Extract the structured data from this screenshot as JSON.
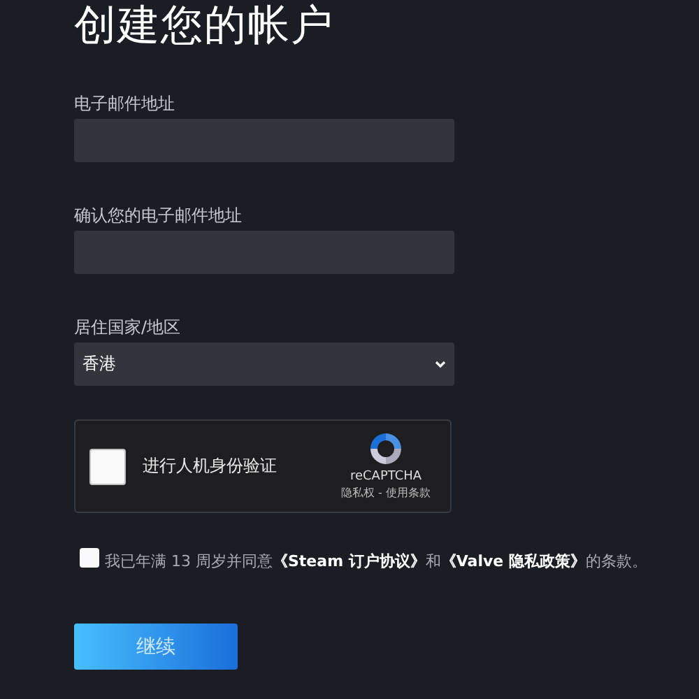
{
  "title": "创建您的帐户",
  "fields": [
    {
      "kind": "text",
      "label": "电子邮件地址"
    },
    {
      "kind": "text",
      "label": "确认您的电子邮件地址"
    },
    {
      "kind": "select",
      "label": "居住国家/地区",
      "value": "香港"
    }
  ],
  "captcha": {
    "checked": false,
    "label": "进行人机身份验证",
    "brand": "reCAPTCHA",
    "links": "隐私权 - 使用条款"
  },
  "agreement": {
    "checked": false,
    "parts": [
      {
        "kind": "text",
        "text": "我已年满 13 周岁并同意"
      },
      {
        "kind": "link",
        "text": "《Steam 订户协议》"
      },
      {
        "kind": "text",
        "text": "和"
      },
      {
        "kind": "link",
        "text": "《Valve 隐私政策》"
      },
      {
        "kind": "text",
        "text": "的条款。"
      }
    ]
  },
  "button": "继续"
}
